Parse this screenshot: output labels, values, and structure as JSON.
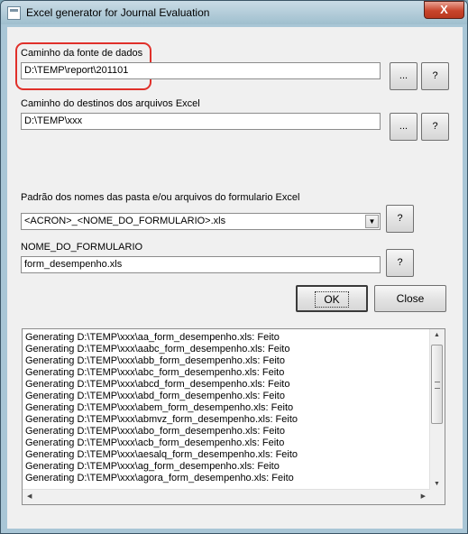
{
  "window": {
    "title": "Excel generator for Journal Evaluation",
    "close_label": "X"
  },
  "source": {
    "label": "Caminho da fonte de dados",
    "value": "D:\\TEMP\\report\\201101",
    "browse_label": "...",
    "help_label": "?"
  },
  "dest": {
    "label": "Caminho do destinos dos arquivos Excel",
    "value": "D:\\TEMP\\xxx",
    "browse_label": "...",
    "help_label": "?"
  },
  "pattern": {
    "label": "Padrão dos nomes das pasta e/ou arquivos do formulario Excel",
    "value": "<ACRON>_<NOME_DO_FORMULARIO>.xls",
    "help_label": "?"
  },
  "form_name": {
    "label": "NOME_DO_FORMULARIO",
    "value": "form_desempenho.xls",
    "help_label": "?"
  },
  "actions": {
    "ok_label": "OK",
    "close_label": "Close"
  },
  "log": {
    "lines": [
      "Generating D:\\TEMP\\xxx\\aa_form_desempenho.xls: Feito",
      "Generating D:\\TEMP\\xxx\\aabc_form_desempenho.xls: Feito",
      "Generating D:\\TEMP\\xxx\\abb_form_desempenho.xls: Feito",
      "Generating D:\\TEMP\\xxx\\abc_form_desempenho.xls: Feito",
      "Generating D:\\TEMP\\xxx\\abcd_form_desempenho.xls: Feito",
      "Generating D:\\TEMP\\xxx\\abd_form_desempenho.xls: Feito",
      "Generating D:\\TEMP\\xxx\\abem_form_desempenho.xls: Feito",
      "Generating D:\\TEMP\\xxx\\abmvz_form_desempenho.xls: Feito",
      "Generating D:\\TEMP\\xxx\\abo_form_desempenho.xls: Feito",
      "Generating D:\\TEMP\\xxx\\acb_form_desempenho.xls: Feito",
      "Generating D:\\TEMP\\xxx\\aesalq_form_desempenho.xls: Feito",
      "Generating D:\\TEMP\\xxx\\ag_form_desempenho.xls: Feito",
      "Generating D:\\TEMP\\xxx\\agora_form_desempenho.xls: Feito"
    ]
  },
  "colors": {
    "highlight": "#e0302a",
    "client_bg": "#f0f0f0",
    "frame": "#a9c6d6"
  }
}
